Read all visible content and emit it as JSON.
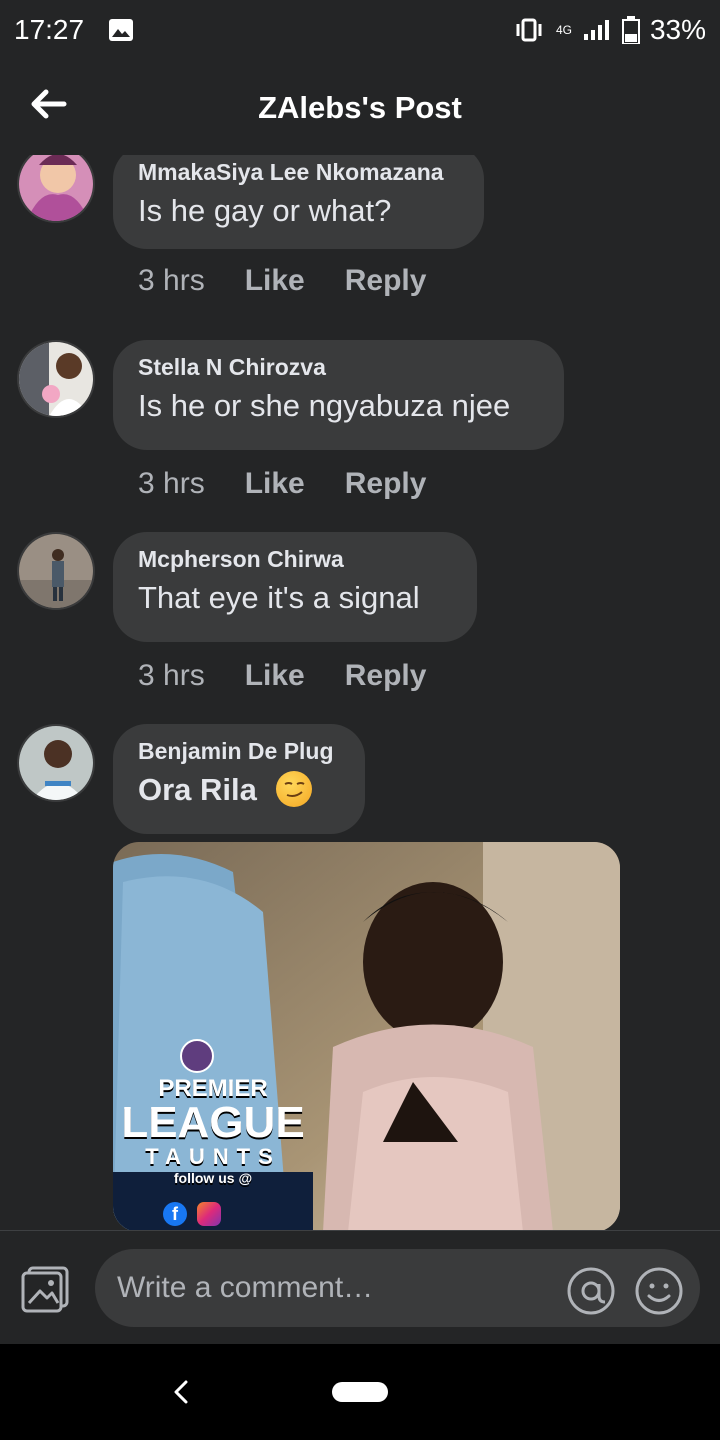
{
  "status_bar": {
    "time": "17:27",
    "network": "4G",
    "battery": "33%",
    "icons": [
      "image-icon",
      "vibrate-icon",
      "signal-icon",
      "battery-icon"
    ]
  },
  "header": {
    "title": "ZAlebs's Post",
    "back_icon": "back-arrow-icon"
  },
  "comments": [
    {
      "author": "MmakaSiya Lee Nkomazana",
      "text": "Is he gay or what?",
      "time": "3 hrs",
      "like": "Like",
      "reply": "Reply"
    },
    {
      "author": "Stella N Chirozva",
      "text": "Is he or she ngyabuza njee",
      "time": "3 hrs",
      "like": "Like",
      "reply": "Reply"
    },
    {
      "author": "Mcpherson Chirwa",
      "text": "That eye it's a signal",
      "time": "3 hrs",
      "like": "Like",
      "reply": "Reply"
    },
    {
      "author": "Benjamin De Plug",
      "text": "Ora Rila",
      "emoji": "smirk-emoji",
      "attachment": {
        "brand_line1": "PREMIER",
        "brand_line2": "LEAGUE",
        "brand_line3": "TAUNTS",
        "follow_text": "follow us @"
      }
    }
  ],
  "composer": {
    "placeholder": "Write a comment…",
    "icons": [
      "photo-icon",
      "mention-icon",
      "emoji-icon"
    ]
  },
  "colors": {
    "background": "#242526",
    "bubble": "#3a3b3c",
    "text": "#e4e6eb",
    "muted": "#b0b3b8"
  }
}
